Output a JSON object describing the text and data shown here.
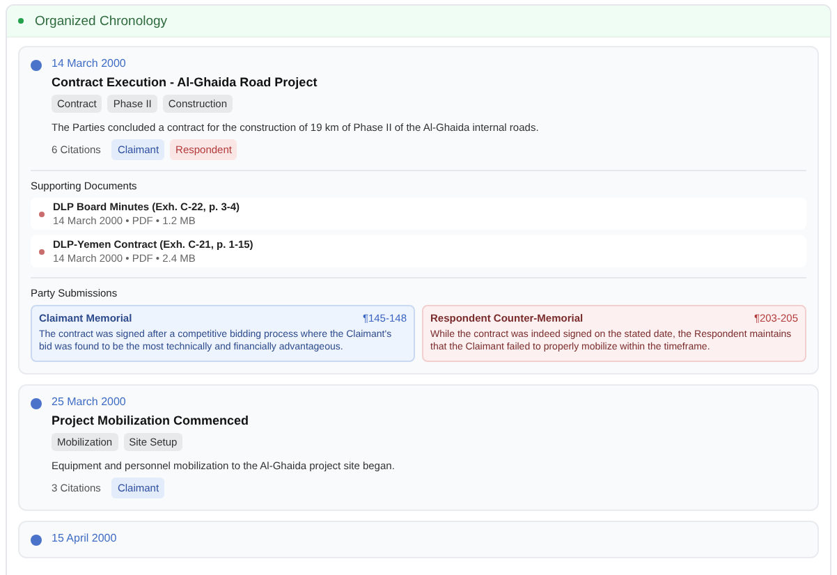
{
  "header": {
    "title": "Organized Chronology"
  },
  "events": [
    {
      "date": "14 March 2000",
      "title": "Contract Execution - Al-Ghaida Road Project",
      "tags": [
        "Contract",
        "Phase II",
        "Construction"
      ],
      "description": "The Parties concluded a contract for the construction of 19 km of Phase II of the Al-Ghaida internal roads.",
      "citations": "6 Citations",
      "parties": [
        {
          "label": "Claimant",
          "kind": "claimant"
        },
        {
          "label": "Respondent",
          "kind": "respondent"
        }
      ],
      "documents_heading": "Supporting Documents",
      "documents": [
        {
          "name": "DLP Board Minutes (Exh. C-22, p. 3-4)",
          "meta": "14 March 2000 • PDF • 1.2 MB"
        },
        {
          "name": "DLP-Yemen Contract (Exh. C-21, p. 1-15)",
          "meta": "14 March 2000 • PDF • 2.4 MB"
        }
      ],
      "submissions_heading": "Party Submissions",
      "submissions": [
        {
          "kind": "claimant",
          "title": "Claimant Memorial",
          "ref": "¶145-148",
          "text": "The contract was signed after a competitive bidding process where the Claimant's bid was found to be the most technically and financially advantageous."
        },
        {
          "kind": "respondent",
          "title": "Respondent Counter-Memorial",
          "ref": "¶203-205",
          "text": "While the contract was indeed signed on the stated date, the Respondent maintains that the Claimant failed to properly mobilize within the timeframe."
        }
      ]
    },
    {
      "date": "25 March 2000",
      "title": "Project Mobilization Commenced",
      "tags": [
        "Mobilization",
        "Site Setup"
      ],
      "description": "Equipment and personnel mobilization to the Al-Ghaida project site began.",
      "citations": "3 Citations",
      "parties": [
        {
          "label": "Claimant",
          "kind": "claimant"
        }
      ]
    },
    {
      "date": "15 April 2000"
    }
  ]
}
